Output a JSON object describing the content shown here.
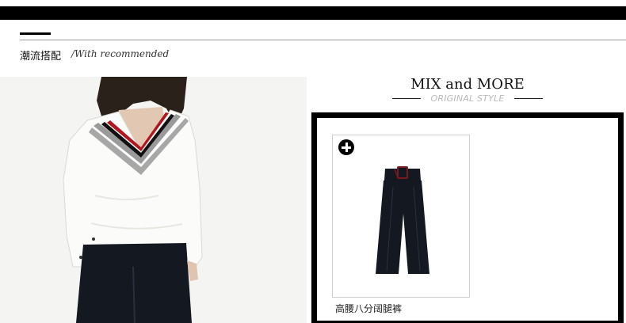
{
  "section": {
    "title_cn": "潮流搭配",
    "title_en": "/With recommended"
  },
  "mix": {
    "title": "MIX and MORE",
    "subtitle": "ORIGINAL STYLE"
  },
  "product": {
    "name": "高腰八分阔腿裤",
    "add_icon": "plus-circle-icon"
  },
  "colors": {
    "bar": "#000000",
    "stripe_red": "#b0161f",
    "stripe_gray": "#8c8c8c",
    "pants": "#141821"
  }
}
